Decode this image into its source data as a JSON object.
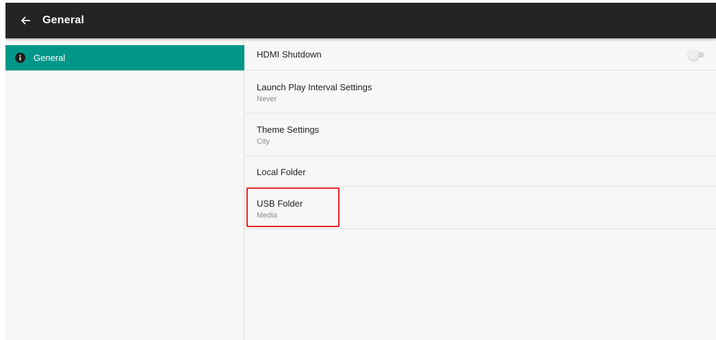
{
  "appbar": {
    "title": "General",
    "back_icon": "arrow-back-icon"
  },
  "sidebar": {
    "items": [
      {
        "label": "General",
        "icon": "info-icon",
        "selected": true
      }
    ]
  },
  "preferences": [
    {
      "title": "HDMI Shutdown",
      "summary": "",
      "toggle": false
    },
    {
      "title": "Launch Play Interval Settings",
      "summary": "Never"
    },
    {
      "title": "Theme Settings",
      "summary": "City"
    },
    {
      "title": "Local Folder",
      "summary": ""
    },
    {
      "title": "USB Folder",
      "summary": "Media"
    }
  ],
  "colors": {
    "appbar": "#242424",
    "accent": "#009688",
    "background": "#f7f7f7",
    "highlight": "#e8232a"
  }
}
